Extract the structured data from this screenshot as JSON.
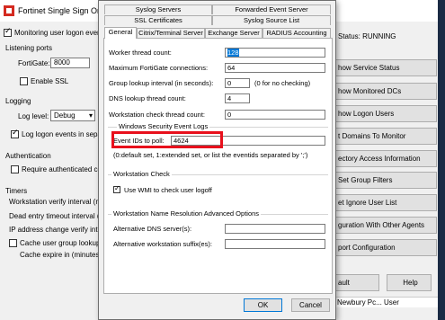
{
  "background_window": {
    "title": "Fortinet Single Sign On Ag",
    "monitoring_checkbox": "Monitoring user logon events",
    "listening_ports_title": "Listening ports",
    "fortigate_label": "FortiGate:",
    "fortigate_value": "8000",
    "enable_ssl_label": "Enable SSL",
    "logging_title": "Logging",
    "log_level_label": "Log level:",
    "log_level_value": "Debug",
    "log_logon_label": "Log logon events in separ",
    "auth_title": "Authentication",
    "require_auth_label": "Require authenticated con",
    "timers_title": "Timers",
    "ws_verify_label": "Workstation verify interval (min",
    "dead_entry_label": "Dead entry timeout interval (min",
    "ip_change_label": "IP address change verify inter",
    "cache_group_label": "Cache user group lookup r",
    "cache_expire_label": "Cache expire in (minutes):",
    "status": "Status: RUNNING",
    "buttons": [
      "how Service Status",
      "how Monitored DCs",
      "how Logon Users",
      "t Domains To Monitor",
      "ectory Access Information",
      "Set Group Filters",
      "et Ignore User List",
      "guration With Other Agents",
      "port Configuration"
    ],
    "default_btn": "ault",
    "help_btn": "Help",
    "list_row": "Newbury Pc...   User"
  },
  "dialog": {
    "tabs_row1": [
      "Syslog Servers",
      "Forwarded Event Server"
    ],
    "tabs_row2": [
      "SSL Certificates",
      "Syslog Source List"
    ],
    "tabs_row3": [
      "General",
      "Citrix/Terminal Server",
      "Exchange Server",
      "RADIUS Accounting"
    ],
    "worker_label": "Worker thread count:",
    "worker_value": "128",
    "max_conn_label": "Maximum FortiGate connections:",
    "max_conn_value": "64",
    "group_lookup_label": "Group lookup interval (in seconds):",
    "group_lookup_value": "0",
    "group_lookup_hint": "(0 for no checking)",
    "dns_thread_label": "DNS lookup thread count:",
    "dns_thread_value": "4",
    "ws_check_label": "Workstation check thread count:",
    "ws_check_value": "0",
    "wsel_section": "Windows Security Event Logs",
    "event_ids_label": "Event IDs to poll:",
    "event_ids_value": "4624",
    "event_ids_hint": "(0:default set, 1:extended set, or list the eventids separated by ';')",
    "ws_check_section": "Workstation Check",
    "use_wmi_label": "Use WMI to check user logoff",
    "wsname_section": "Workstation Name Resolution Advanced Options",
    "alt_dns_label": "Alternative DNS server(s):",
    "alt_dns_value": "",
    "alt_suffix_label": "Alternative workstation suffix(es):",
    "alt_suffix_value": "",
    "ok_label": "OK",
    "cancel_label": "Cancel"
  },
  "colors": {
    "highlight": "#e8101c",
    "selection": "#0078d7",
    "brand": "#d42a20"
  }
}
